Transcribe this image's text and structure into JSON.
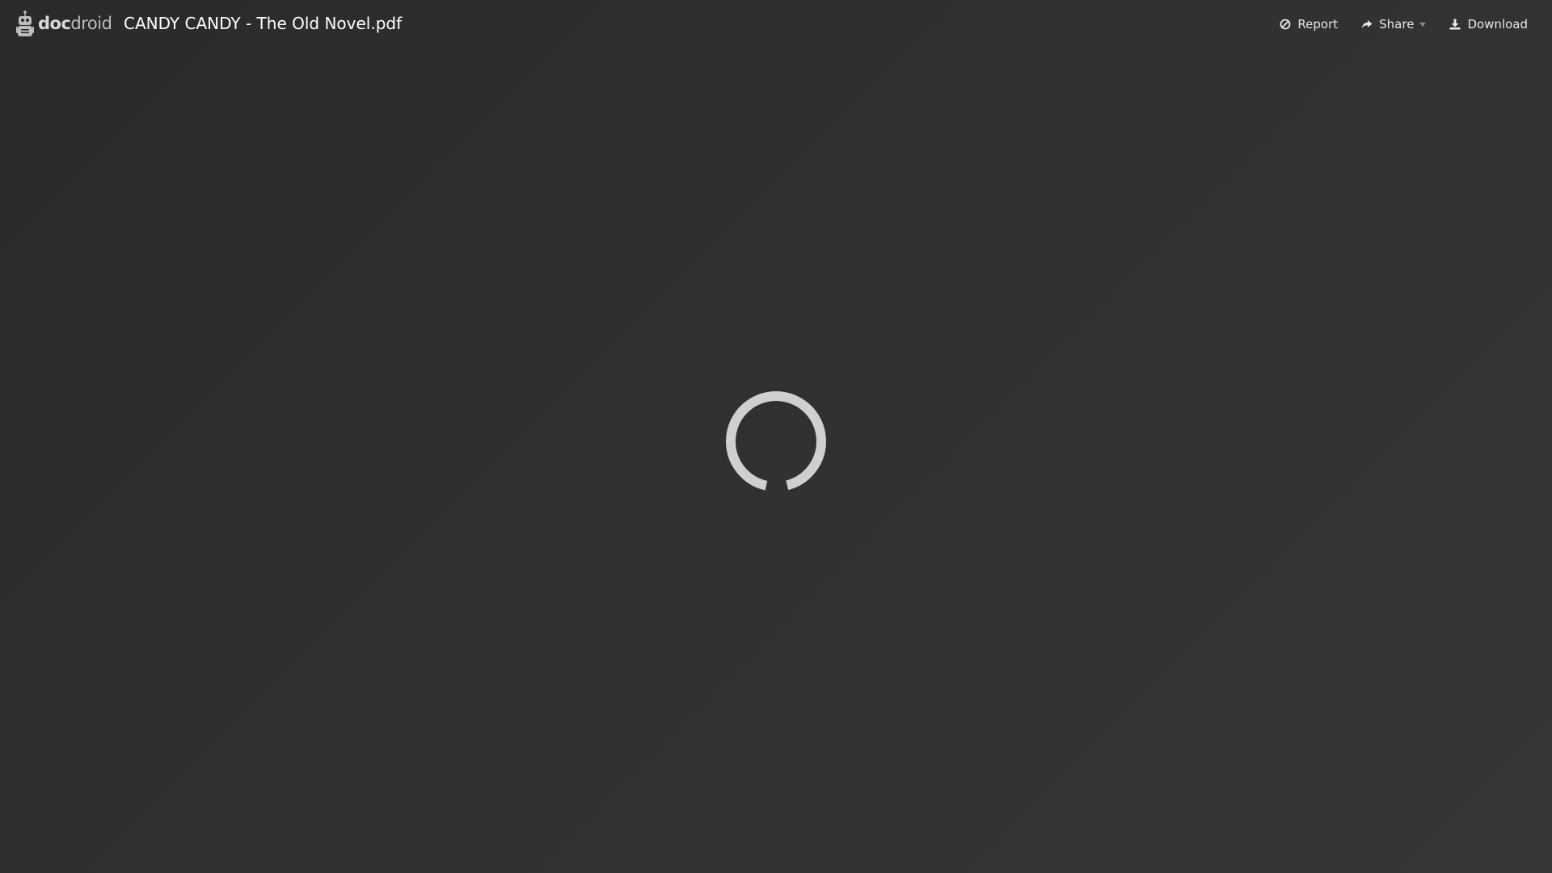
{
  "brand": {
    "name_bold": "doc",
    "name_light": "droid",
    "icon": "robot-logo-icon"
  },
  "document": {
    "title": "CANDY CANDY - The Old Novel.pdf"
  },
  "actions": {
    "report": {
      "label": "Report",
      "icon": "ban-icon"
    },
    "share": {
      "label": "Share",
      "icon": "share-arrow-icon",
      "has_dropdown": true
    },
    "download": {
      "label": "Download",
      "icon": "download-icon"
    }
  },
  "viewer": {
    "state": "loading",
    "indicator": "spinner"
  },
  "colors": {
    "background_dark": "#2a2a2a",
    "background_light": "#363636",
    "text": "#e8e8e8",
    "title": "#ffffff",
    "spinner": "#cfcfcf"
  }
}
